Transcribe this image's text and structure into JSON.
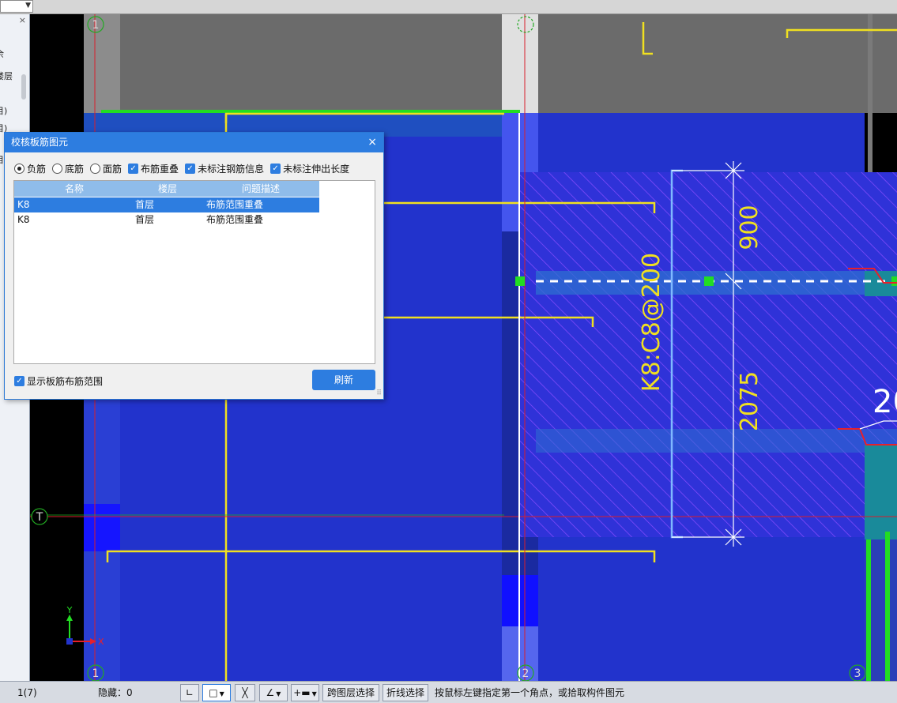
{
  "dialog": {
    "title": "校核板筋图元",
    "close": "×",
    "radios": [
      {
        "label": "负筋",
        "checked": true
      },
      {
        "label": "底筋",
        "checked": false
      },
      {
        "label": "面筋",
        "checked": false
      }
    ],
    "checks": [
      {
        "label": "布筋重叠",
        "checked": true
      },
      {
        "label": "未标注钢筋信息",
        "checked": true
      },
      {
        "label": "未标注伸出长度",
        "checked": true
      }
    ],
    "columns": [
      "名称",
      "楼层",
      "问题描述"
    ],
    "rows": [
      {
        "name": "K8",
        "floor": "首层",
        "desc": "布筋范围重叠",
        "selected": true
      },
      {
        "name": "K8",
        "floor": "首层",
        "desc": "布筋范围重叠",
        "selected": false
      }
    ],
    "show_range": "显示板筋布筋范围",
    "refresh": "刷新"
  },
  "left_panel": {
    "close": "×",
    "items": [
      "余",
      "楼层",
      "目)",
      "目)",
      "",
      "目",
      "",
      "",
      "",
      ""
    ]
  },
  "canvas": {
    "axis_labels": {
      "top_1": "1",
      "top_2": "",
      "bottom_1": "1",
      "bottom_2": "2",
      "bottom_3": "3",
      "left_T": "T"
    },
    "rebar_label": "K8:C8@200",
    "dim_top": "900",
    "dim_bottom": "2075",
    "partial_text": "20",
    "ucs": {
      "y": "Y",
      "x": "X"
    },
    "colors": {
      "slab_blue": "#2233cc",
      "slab_dark": "#1d2ab8",
      "hatch": "#8a4dff",
      "yellow_line": "#f0e020",
      "green_line": "#22dd22",
      "red_axis": "#d81f2c",
      "dim_white": "#ffffff",
      "gray": "#6b6b6b"
    }
  },
  "statusbar": {
    "page": "1(7)",
    "hidden": "隐藏：0",
    "btn_cross_layer": "跨图层选择",
    "btn_polyline": "折线选择",
    "hint": "按鼠标左键指定第一个角点，或拾取构件图元"
  }
}
